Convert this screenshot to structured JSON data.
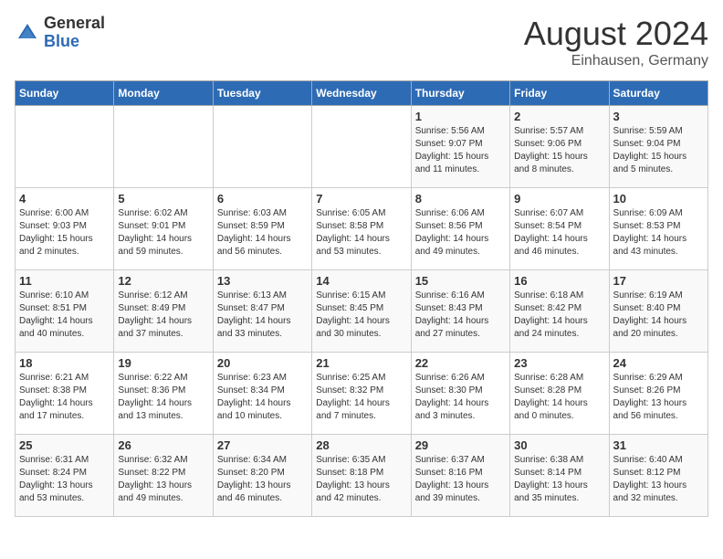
{
  "logo": {
    "general": "General",
    "blue": "Blue"
  },
  "header": {
    "month": "August 2024",
    "location": "Einhausen, Germany"
  },
  "days_of_week": [
    "Sunday",
    "Monday",
    "Tuesday",
    "Wednesday",
    "Thursday",
    "Friday",
    "Saturday"
  ],
  "weeks": [
    [
      {
        "day": "",
        "info": ""
      },
      {
        "day": "",
        "info": ""
      },
      {
        "day": "",
        "info": ""
      },
      {
        "day": "",
        "info": ""
      },
      {
        "day": "1",
        "info": "Sunrise: 5:56 AM\nSunset: 9:07 PM\nDaylight: 15 hours\nand 11 minutes."
      },
      {
        "day": "2",
        "info": "Sunrise: 5:57 AM\nSunset: 9:06 PM\nDaylight: 15 hours\nand 8 minutes."
      },
      {
        "day": "3",
        "info": "Sunrise: 5:59 AM\nSunset: 9:04 PM\nDaylight: 15 hours\nand 5 minutes."
      }
    ],
    [
      {
        "day": "4",
        "info": "Sunrise: 6:00 AM\nSunset: 9:03 PM\nDaylight: 15 hours\nand 2 minutes."
      },
      {
        "day": "5",
        "info": "Sunrise: 6:02 AM\nSunset: 9:01 PM\nDaylight: 14 hours\nand 59 minutes."
      },
      {
        "day": "6",
        "info": "Sunrise: 6:03 AM\nSunset: 8:59 PM\nDaylight: 14 hours\nand 56 minutes."
      },
      {
        "day": "7",
        "info": "Sunrise: 6:05 AM\nSunset: 8:58 PM\nDaylight: 14 hours\nand 53 minutes."
      },
      {
        "day": "8",
        "info": "Sunrise: 6:06 AM\nSunset: 8:56 PM\nDaylight: 14 hours\nand 49 minutes."
      },
      {
        "day": "9",
        "info": "Sunrise: 6:07 AM\nSunset: 8:54 PM\nDaylight: 14 hours\nand 46 minutes."
      },
      {
        "day": "10",
        "info": "Sunrise: 6:09 AM\nSunset: 8:53 PM\nDaylight: 14 hours\nand 43 minutes."
      }
    ],
    [
      {
        "day": "11",
        "info": "Sunrise: 6:10 AM\nSunset: 8:51 PM\nDaylight: 14 hours\nand 40 minutes."
      },
      {
        "day": "12",
        "info": "Sunrise: 6:12 AM\nSunset: 8:49 PM\nDaylight: 14 hours\nand 37 minutes."
      },
      {
        "day": "13",
        "info": "Sunrise: 6:13 AM\nSunset: 8:47 PM\nDaylight: 14 hours\nand 33 minutes."
      },
      {
        "day": "14",
        "info": "Sunrise: 6:15 AM\nSunset: 8:45 PM\nDaylight: 14 hours\nand 30 minutes."
      },
      {
        "day": "15",
        "info": "Sunrise: 6:16 AM\nSunset: 8:43 PM\nDaylight: 14 hours\nand 27 minutes."
      },
      {
        "day": "16",
        "info": "Sunrise: 6:18 AM\nSunset: 8:42 PM\nDaylight: 14 hours\nand 24 minutes."
      },
      {
        "day": "17",
        "info": "Sunrise: 6:19 AM\nSunset: 8:40 PM\nDaylight: 14 hours\nand 20 minutes."
      }
    ],
    [
      {
        "day": "18",
        "info": "Sunrise: 6:21 AM\nSunset: 8:38 PM\nDaylight: 14 hours\nand 17 minutes."
      },
      {
        "day": "19",
        "info": "Sunrise: 6:22 AM\nSunset: 8:36 PM\nDaylight: 14 hours\nand 13 minutes."
      },
      {
        "day": "20",
        "info": "Sunrise: 6:23 AM\nSunset: 8:34 PM\nDaylight: 14 hours\nand 10 minutes."
      },
      {
        "day": "21",
        "info": "Sunrise: 6:25 AM\nSunset: 8:32 PM\nDaylight: 14 hours\nand 7 minutes."
      },
      {
        "day": "22",
        "info": "Sunrise: 6:26 AM\nSunset: 8:30 PM\nDaylight: 14 hours\nand 3 minutes."
      },
      {
        "day": "23",
        "info": "Sunrise: 6:28 AM\nSunset: 8:28 PM\nDaylight: 14 hours\nand 0 minutes."
      },
      {
        "day": "24",
        "info": "Sunrise: 6:29 AM\nSunset: 8:26 PM\nDaylight: 13 hours\nand 56 minutes."
      }
    ],
    [
      {
        "day": "25",
        "info": "Sunrise: 6:31 AM\nSunset: 8:24 PM\nDaylight: 13 hours\nand 53 minutes."
      },
      {
        "day": "26",
        "info": "Sunrise: 6:32 AM\nSunset: 8:22 PM\nDaylight: 13 hours\nand 49 minutes."
      },
      {
        "day": "27",
        "info": "Sunrise: 6:34 AM\nSunset: 8:20 PM\nDaylight: 13 hours\nand 46 minutes."
      },
      {
        "day": "28",
        "info": "Sunrise: 6:35 AM\nSunset: 8:18 PM\nDaylight: 13 hours\nand 42 minutes."
      },
      {
        "day": "29",
        "info": "Sunrise: 6:37 AM\nSunset: 8:16 PM\nDaylight: 13 hours\nand 39 minutes."
      },
      {
        "day": "30",
        "info": "Sunrise: 6:38 AM\nSunset: 8:14 PM\nDaylight: 13 hours\nand 35 minutes."
      },
      {
        "day": "31",
        "info": "Sunrise: 6:40 AM\nSunset: 8:12 PM\nDaylight: 13 hours\nand 32 minutes."
      }
    ]
  ]
}
